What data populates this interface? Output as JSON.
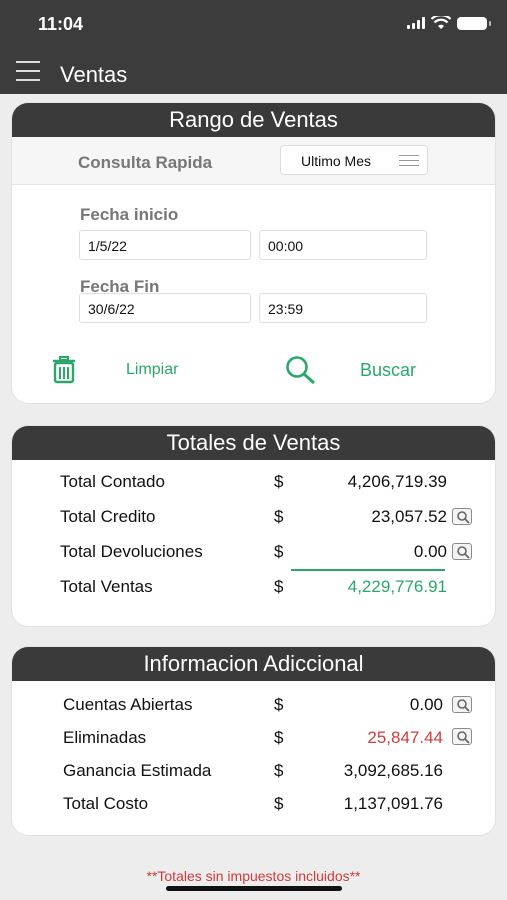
{
  "status": {
    "time": "11:04"
  },
  "nav": {
    "title": "Ventas"
  },
  "rango": {
    "header": "Rango de Ventas",
    "quick_label": "Consulta Rapida",
    "quick_value": "Ultimo Mes",
    "start_label": "Fecha inicio",
    "start_date": "1/5/22",
    "start_time": "00:00",
    "end_label": "Fecha Fin",
    "end_date": "30/6/22",
    "end_time": "23:59",
    "clear_label": "Limpiar",
    "search_label": "Buscar"
  },
  "totales": {
    "header": "Totales de Ventas",
    "rows": [
      {
        "label": "Total Contado",
        "currency": "$",
        "amount": "4,206,719.39"
      },
      {
        "label": "Total Credito",
        "currency": "$",
        "amount": "23,057.52"
      },
      {
        "label": "Total Devoluciones",
        "currency": "$",
        "amount": "0.00"
      },
      {
        "label": "Total Ventas",
        "currency": "$",
        "amount": "4,229,776.91"
      }
    ]
  },
  "info": {
    "header": "Informacion Adiccional",
    "rows": [
      {
        "label": "Cuentas Abiertas",
        "currency": "$",
        "amount": "0.00"
      },
      {
        "label": "Eliminadas",
        "currency": "$",
        "amount": "25,847.44"
      },
      {
        "label": "Ganancia Estimada",
        "currency": "$",
        "amount": "3,092,685.16"
      },
      {
        "label": "Total Costo",
        "currency": "$",
        "amount": "1,137,091.76"
      }
    ]
  },
  "footer": {
    "note": "**Totales sin impuestos incluidos**"
  },
  "colors": {
    "accent": "#2aa86a",
    "alert": "#d23b3b",
    "header": "#3a3a3a"
  },
  "icons": [
    "menu-icon",
    "trash-icon",
    "search-icon",
    "magnifier-icon",
    "signal-icon",
    "wifi-icon",
    "battery-icon"
  ]
}
